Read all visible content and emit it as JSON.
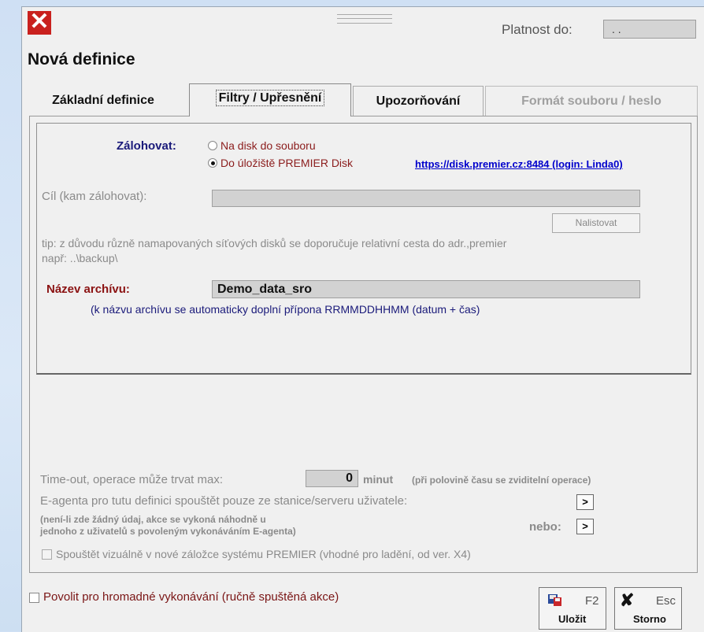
{
  "window": {
    "title": "Nová definice",
    "valid_label": "Platnost do:",
    "valid_value": ". ."
  },
  "tabs": [
    {
      "label": "Základní definice"
    },
    {
      "label": "Filtry / Upřesnění"
    },
    {
      "label": "Upozorňování"
    },
    {
      "label": "Formát souboru / heslo"
    }
  ],
  "backup": {
    "label": "Zálohovat:",
    "option_disk": "Na disk do souboru",
    "option_cloud": "Do úložiště PREMIER Disk",
    "cloud_link": "https://disk.premier.cz:8484 (login: Linda0)",
    "target_label": "Cíl (kam zálohovat):",
    "target_value": "",
    "browse_button": "Nalistovat",
    "tip_line1": "tip: z důvodu různě namapovaných síťových disků se doporučuje relativní cesta do adr.,premier",
    "tip_line2": "např: ..\\backup\\",
    "archive_label": "Název archívu:",
    "archive_value": "Demo_data_sro",
    "archive_hint": "(k názvu archívu se automaticky doplní přípona RRMMDDHHMM (datum + čas)"
  },
  "options": {
    "timeout_label": "Time-out, operace může trvat max:",
    "timeout_value": "0",
    "timeout_unit": "minut",
    "timeout_hint": "(při polovině času se zviditelní operace)",
    "agent_label": "E-agenta pro tutu definici spouštět pouze ze stanice/serveru uživatele:",
    "agent_note_line1": "(není-li zde žádný údaj, akce se vykoná náhodně u",
    "agent_note_line2": "jednoho z uživatelů s povoleným vykonáváním E-agenta)",
    "or_label": "nebo:",
    "arrow": ">",
    "visual_label": "Spouštět vizuálně v nové záložce systému PREMIER (vhodné pro ladění, od ver. X4)"
  },
  "footer": {
    "bulk_label": "Povolit pro hromadné vykonávání (ručně spuštěná akce)",
    "save_key": "F2",
    "save_label": "Uložit",
    "cancel_key": "Esc",
    "cancel_label": "Storno"
  }
}
